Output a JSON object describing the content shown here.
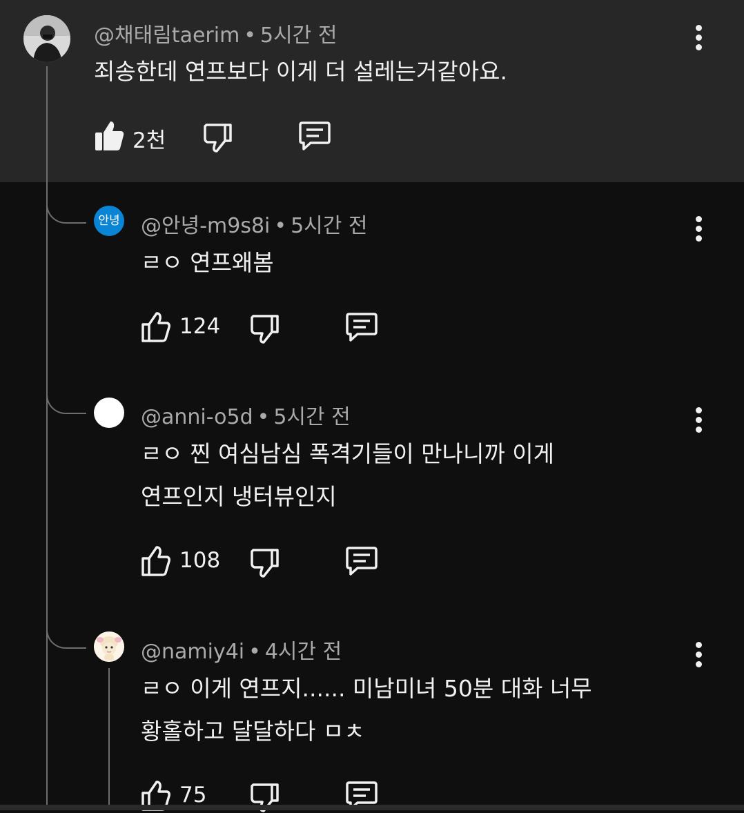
{
  "comments": [
    {
      "author": "@채태림taerim",
      "time": "5시간 전",
      "text_lines": [
        "죄송한데 연프보다 이게 더 설레는거같아요."
      ],
      "likes": "2천",
      "avatar": "photo-avatar",
      "liked": true
    },
    {
      "author": "@안녕-m9s8i",
      "time": "5시간 전",
      "text_lines": [
        "ㄹㅇ 연프왜봄"
      ],
      "likes": "124",
      "avatar_text": "안녕",
      "avatar_color": "#0a84d4"
    },
    {
      "author": "@anni-o5d",
      "time": "5시간 전",
      "text_lines": [
        "ㄹㅇ 찐 여심남심 폭격기들이 만나니까 이게",
        "연프인지 냉터뷰인지"
      ],
      "likes": "108",
      "avatar_color": "#ffffff"
    },
    {
      "author": "@namiy4i",
      "time": "4시간 전",
      "text_lines": [
        "ㄹㅇ 이게 연프지...... 미남미녀 50분 대화 너무",
        "황홀하고 달달하다 ㅁㅊ"
      ],
      "likes": "75",
      "avatar": "sheep-avatar"
    }
  ],
  "colors": {
    "top_bg": "#272727",
    "page_bg": "#0f0f0f",
    "meta_text": "#aaaaaa",
    "thread_line": "#6e6e6e"
  },
  "icons": [
    "thumb-up-icon",
    "thumb-down-icon",
    "reply-icon",
    "more-vert-icon"
  ]
}
